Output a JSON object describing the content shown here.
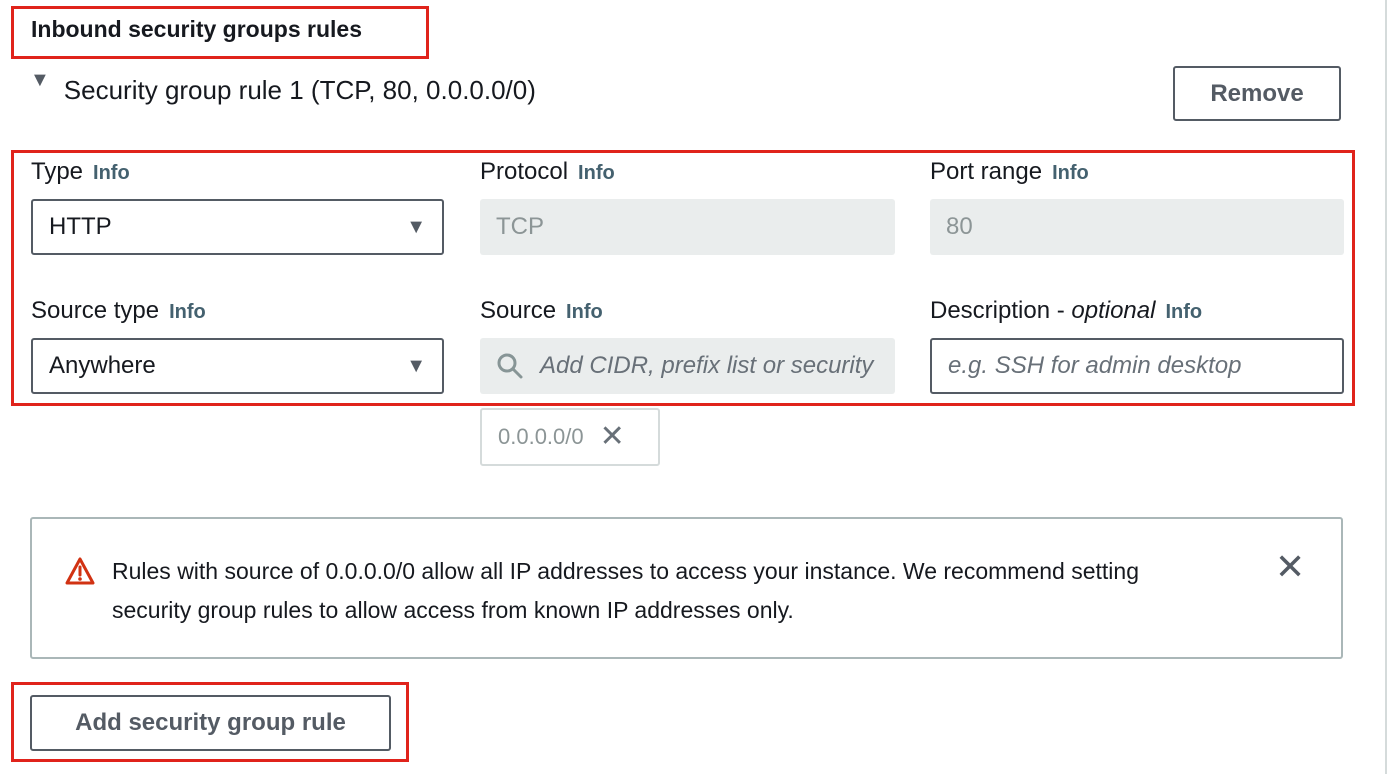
{
  "section": {
    "title": "Inbound security groups rules"
  },
  "rule": {
    "title": "Security group rule 1 (TCP, 80, 0.0.0.0/0)",
    "remove_label": "Remove"
  },
  "info_label": "Info",
  "fields": {
    "type": {
      "label": "Type",
      "value": "HTTP"
    },
    "protocol": {
      "label": "Protocol",
      "value": "TCP"
    },
    "port_range": {
      "label": "Port range",
      "value": "80"
    },
    "source_type": {
      "label": "Source type",
      "value": "Anywhere"
    },
    "source": {
      "label": "Source",
      "placeholder": "Add CIDR, prefix list or security",
      "token": "0.0.0.0/0"
    },
    "description": {
      "label": "Description - ",
      "label_optional": "optional",
      "placeholder": "e.g. SSH for admin desktop"
    }
  },
  "alert": {
    "line1": "Rules with source of 0.0.0.0/0 allow all IP addresses to access your instance. We recommend setting",
    "line2": "security group rules to allow access from known IP addresses only."
  },
  "add_rule_label": "Add security group rule",
  "icons": {
    "expand": "caret-down-icon",
    "dropdown": "caret-down-icon",
    "search": "search-icon",
    "warning": "warning-icon",
    "close": "close-icon"
  },
  "colors": {
    "highlight": "#e0231b",
    "info_link": "#44616f",
    "warning": "#d13212",
    "disabled_bg": "#eaeded"
  }
}
